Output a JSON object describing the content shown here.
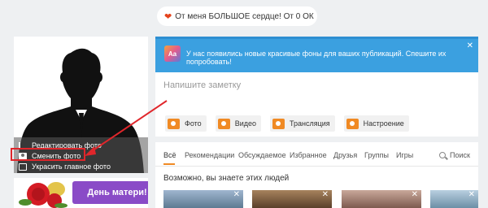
{
  "notification": {
    "text": "От меня БОЛЬШОЕ сердце! От 0 ОК"
  },
  "photo_menu": {
    "edit": "Редактировать фото",
    "change": "Сменить фото",
    "decorate": "Украсить главное фото"
  },
  "promo": {
    "button": "День матери!"
  },
  "banner": {
    "icon_text": "Aa",
    "text": "У нас появились новые красивые фоны для ваших публикаций. Спешите их попробовать!",
    "close": "✕"
  },
  "post": {
    "placeholder": "Напишите заметку",
    "actions": [
      "Фото",
      "Видео",
      "Трансляция",
      "Настроение"
    ]
  },
  "feed": {
    "tabs": [
      "Всё",
      "Рекомендации",
      "Обсуждаемое",
      "Избранное",
      "Друзья",
      "Группы",
      "Игры"
    ],
    "search": "Поиск",
    "people_title": "Возможно, вы знаете этих людей"
  },
  "colors": {
    "accent": "#f08a24",
    "banner": "#3ba0e0",
    "promo": "#8a4bc7",
    "annotation": "#e0262b"
  }
}
